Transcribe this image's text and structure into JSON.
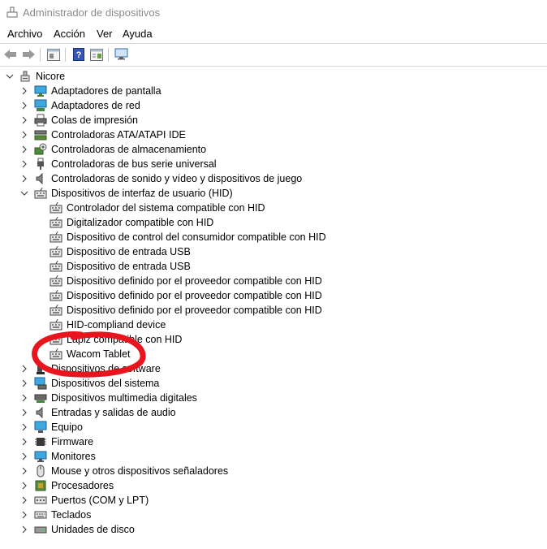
{
  "window": {
    "title": "Administrador de dispositivos"
  },
  "menu": [
    "Archivo",
    "Acción",
    "Ver",
    "Ayuda"
  ],
  "tree": {
    "root": "Nicore",
    "categories_before": [
      {
        "label": "Adaptadores de pantalla",
        "icon": "display-adapter-icon"
      },
      {
        "label": "Adaptadores de red",
        "icon": "network-adapter-icon"
      },
      {
        "label": "Colas de impresión",
        "icon": "printer-icon"
      },
      {
        "label": "Controladoras ATA/ATAPI IDE",
        "icon": "ide-controller-icon"
      },
      {
        "label": "Controladoras de almacenamiento",
        "icon": "storage-controller-icon"
      },
      {
        "label": "Controladoras de bus serie universal",
        "icon": "usb-icon"
      },
      {
        "label": "Controladoras de sonido y vídeo y dispositivos de juego",
        "icon": "speaker-icon"
      }
    ],
    "hid": {
      "label": "Dispositivos de interfaz de usuario (HID)",
      "children": [
        "Controlador del sistema compatible con HID",
        "Digitalizador compatible con HID",
        "Dispositivo de control del consumidor compatible con HID",
        "Dispositivo de entrada USB",
        "Dispositivo de entrada USB",
        "Dispositivo definido por el proveedor compatible con HID",
        "Dispositivo definido por el proveedor compatible con HID",
        "Dispositivo definido por el proveedor compatible con HID",
        "HID-compliand device",
        "Lápiz compatible con HID",
        "Wacom Tablet"
      ]
    },
    "categories_after": [
      {
        "label": "Dispositivos de software",
        "icon": "software-device-icon"
      },
      {
        "label": "Dispositivos del sistema",
        "icon": "system-device-icon"
      },
      {
        "label": "Dispositivos multimedia digitales",
        "icon": "multimedia-icon"
      },
      {
        "label": "Entradas y salidas de audio",
        "icon": "speaker-icon"
      },
      {
        "label": "Equipo",
        "icon": "computer-icon"
      },
      {
        "label": "Firmware",
        "icon": "firmware-icon"
      },
      {
        "label": "Monitores",
        "icon": "monitor-icon"
      },
      {
        "label": "Mouse y otros dispositivos señaladores",
        "icon": "mouse-icon"
      },
      {
        "label": "Procesadores",
        "icon": "processor-icon"
      },
      {
        "label": "Puertos (COM y LPT)",
        "icon": "port-icon"
      },
      {
        "label": "Teclados",
        "icon": "keyboard-icon"
      },
      {
        "label": "Unidades de disco",
        "icon": "disk-drive-icon"
      }
    ]
  },
  "annotation": {
    "color": "#e8141e"
  }
}
